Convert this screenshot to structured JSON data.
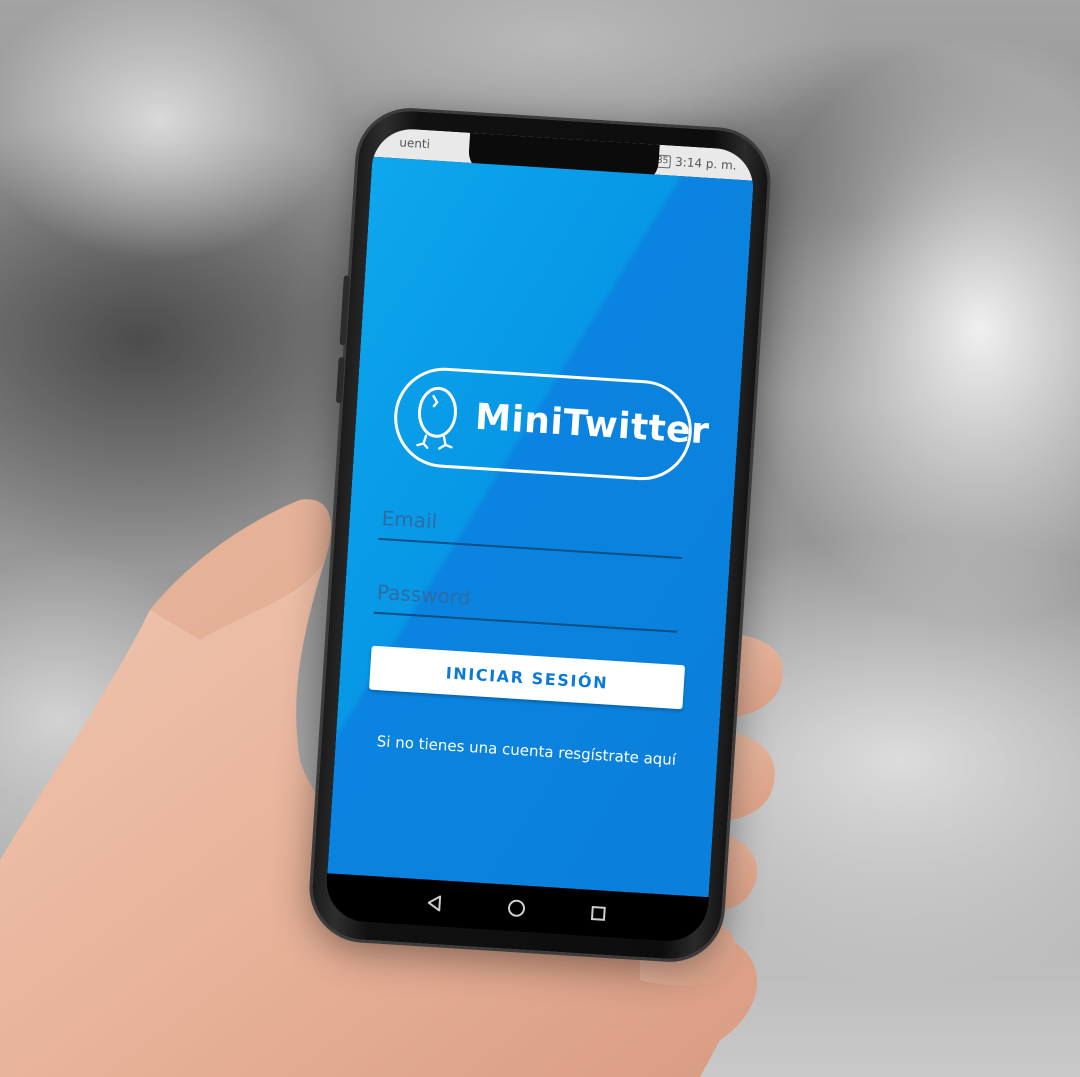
{
  "status_bar": {
    "carrier": "uenti",
    "battery": "85",
    "time": "3:14 p. m."
  },
  "app": {
    "name": "MiniTwitter",
    "logo_icon": "chick-icon",
    "email_placeholder": "Email",
    "password_placeholder": "Password",
    "login_button": "INICIAR SESIÓN",
    "register_link": "Si no tienes una cuenta resgístrate aquí"
  },
  "navigation": {
    "back": "back-triangle-icon",
    "home": "home-circle-icon",
    "recents": "recents-square-icon"
  },
  "colors": {
    "brand_blue": "#0a84e0",
    "button_text": "#0a7ad6"
  }
}
